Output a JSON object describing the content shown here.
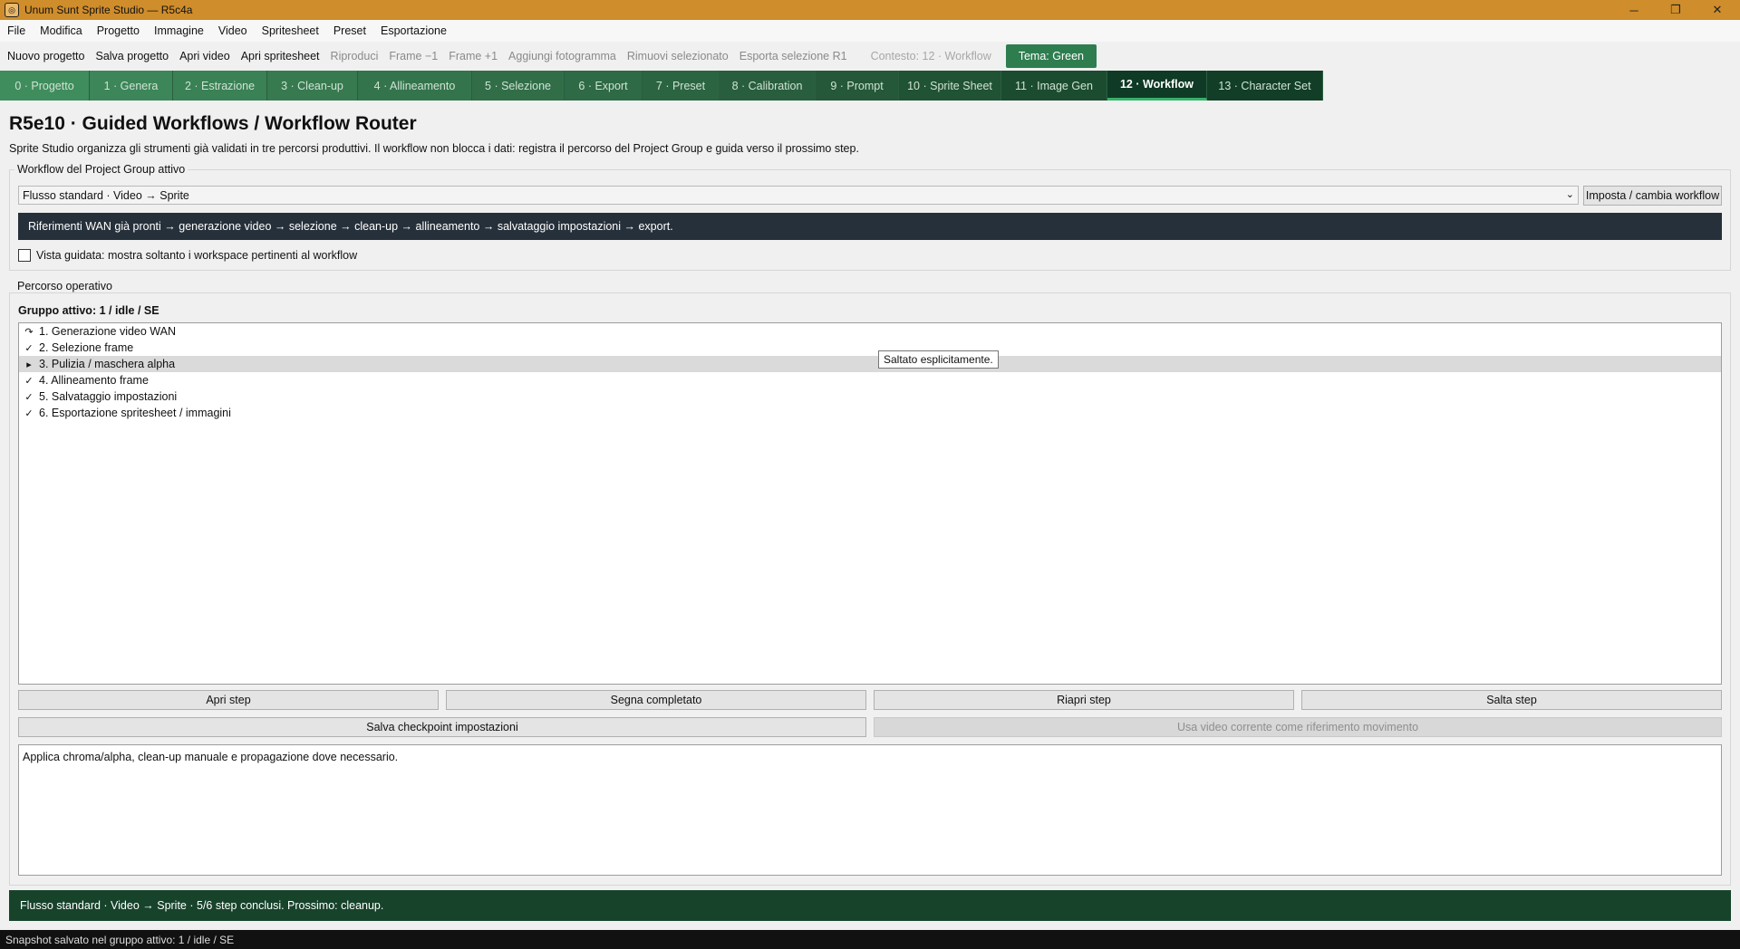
{
  "window": {
    "title": "Unum Sunt Sprite Studio — R5c4a",
    "icon": "app-logo-icon",
    "controls": [
      "minimize-icon",
      "restore-icon",
      "close-icon"
    ]
  },
  "menu": [
    "File",
    "Modifica",
    "Progetto",
    "Immagine",
    "Video",
    "Spritesheet",
    "Preset",
    "Esportazione"
  ],
  "toolbar": {
    "items": [
      {
        "label": "Nuovo progetto",
        "enabled": true
      },
      {
        "label": "Salva progetto",
        "enabled": true
      },
      {
        "label": "Apri video",
        "enabled": true
      },
      {
        "label": "Apri spritesheet",
        "enabled": true
      },
      {
        "label": "Riproduci",
        "enabled": false
      },
      {
        "label": "Frame −1",
        "enabled": false
      },
      {
        "label": "Frame +1",
        "enabled": false
      },
      {
        "label": "Aggiungi fotogramma",
        "enabled": false
      },
      {
        "label": "Rimuovi selezionato",
        "enabled": false
      },
      {
        "label": "Esporta selezione R1",
        "enabled": false
      }
    ],
    "context": "Contesto: 12 · Workflow",
    "theme": "Tema: Green"
  },
  "tabs": [
    {
      "label": "0 · Progetto",
      "color": "#3f8d5d"
    },
    {
      "label": "1 · Genera",
      "color": "#3c8659"
    },
    {
      "label": "2 · Estrazione",
      "color": "#3a8155"
    },
    {
      "label": "3 · Clean-up",
      "color": "#377a50"
    },
    {
      "label": "4 · Allineamento",
      "color": "#34744c"
    },
    {
      "label": "5 · Selezione",
      "color": "#316e48"
    },
    {
      "label": "6 · Export",
      "color": "#2e6a45"
    },
    {
      "label": "7 · Preset",
      "color": "#2b6441"
    },
    {
      "label": "8 · Calibration",
      "color": "#285e3d"
    },
    {
      "label": "9 · Prompt",
      "color": "#245838"
    },
    {
      "label": "10 · Sprite Sheet",
      "color": "#205234"
    },
    {
      "label": "11 · Image Gen",
      "color": "#1c4c30"
    },
    {
      "label": "12 · Workflow",
      "color": "#0f3a25",
      "selected": true
    },
    {
      "label": "13 · Character Set",
      "color": "#123e28"
    }
  ],
  "page": {
    "title": "R5e10 · Guided Workflows / Workflow Router",
    "description": "Sprite Studio organizza gli strumenti già validati in tre percorsi produttivi. Il workflow non blocca i dati: registra il percorso del Project Group e guida verso il prossimo step."
  },
  "workflow_group": {
    "title": "Workflow del Project Group attivo",
    "selected": "Flusso standard · Video → Sprite",
    "set_button": "Imposta / cambia workflow",
    "banner": "Riferimenti WAN già pronti → generazione video → selezione → clean-up → allineamento → salvataggio impostazioni → export.",
    "guided_view_label": "Vista guidata: mostra soltanto i workspace pertinenti al workflow",
    "guided_view_checked": false
  },
  "path_group": {
    "title": "Percorso operativo",
    "active_group": "Gruppo attivo: 1 / idle / SE",
    "steps": [
      {
        "marker": "↷",
        "label": "1. Generazione video WAN"
      },
      {
        "marker": "✓",
        "label": "2. Selezione frame"
      },
      {
        "marker": "▸",
        "label": "3. Pulizia / maschera alpha",
        "selected": true
      },
      {
        "marker": "✓",
        "label": "4. Allineamento frame"
      },
      {
        "marker": "✓",
        "label": "5. Salvataggio impostazioni"
      },
      {
        "marker": "✓",
        "label": "6. Esportazione spritesheet / immagini"
      }
    ],
    "tooltip": "Saltato esplicitamente.",
    "buttons": {
      "open": "Apri step",
      "complete": "Segna completato",
      "reopen": "Riapri step",
      "skip": "Salta step",
      "checkpoint": "Salva checkpoint impostazioni",
      "use_video": "Usa video corrente come riferimento movimento"
    },
    "notes": "Applica chroma/alpha, clean-up manuale e propagazione dove necessario."
  },
  "status": "Flusso standard · Video → Sprite · 5/6 step conclusi. Prossimo: cleanup.",
  "footer": "Snapshot salvato nel gruppo attivo: 1 / idle / SE"
}
